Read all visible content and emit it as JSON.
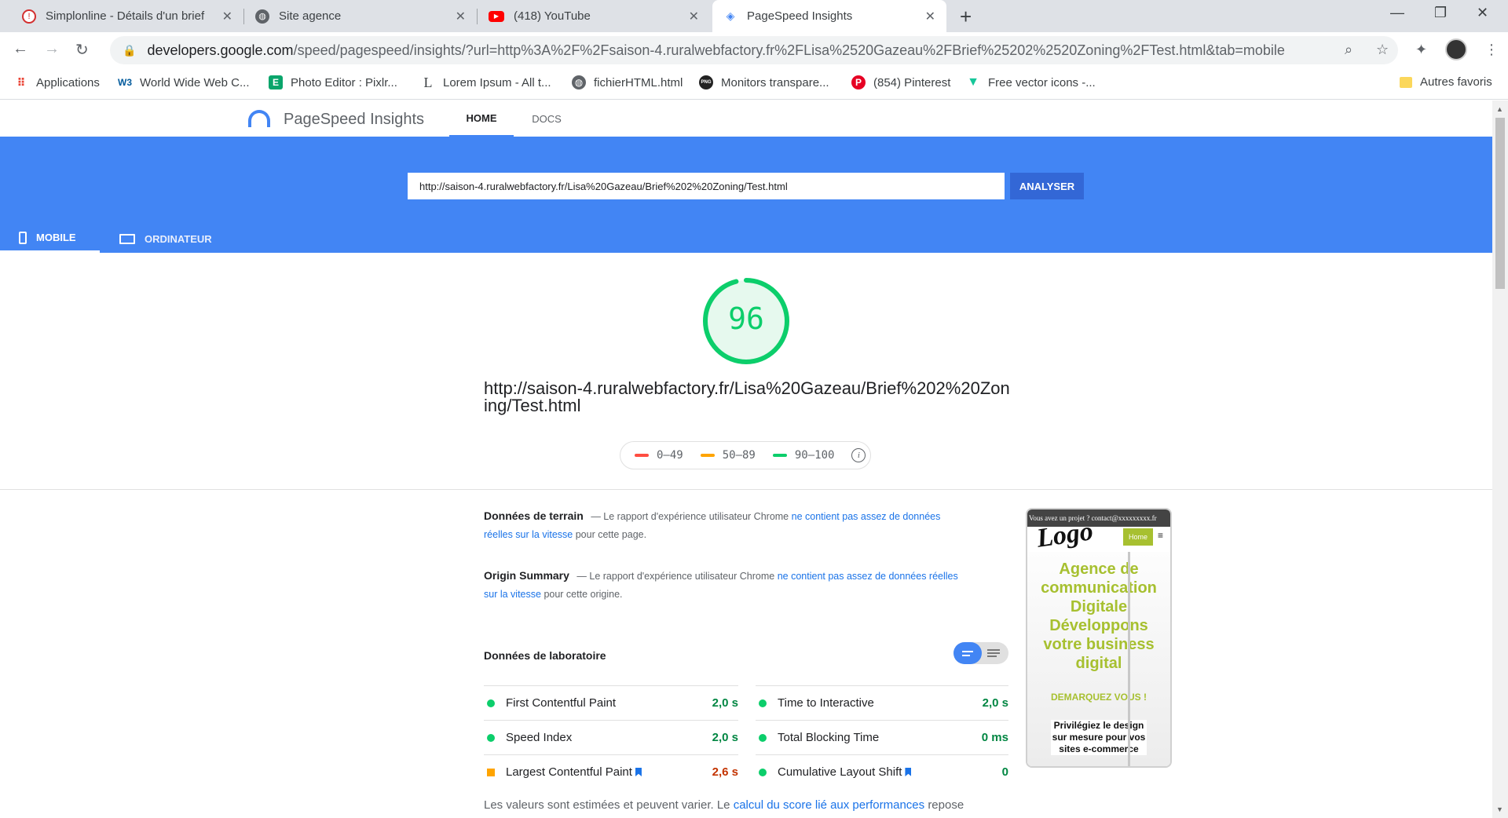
{
  "browser": {
    "tabs": [
      {
        "title": "Simplonline - Détails d'un brief",
        "icon": "simplon-icon"
      },
      {
        "title": "Site agence",
        "icon": "globe-icon"
      },
      {
        "title": "(418) YouTube",
        "icon": "youtube-icon"
      },
      {
        "title": "PageSpeed Insights",
        "icon": "pagespeed-icon",
        "active": true
      }
    ],
    "address": {
      "host": "developers.google.com",
      "path": "/speed/pagespeed/insights/?url=http%3A%2F%2Fsaison-4.ruralwebfactory.fr%2FLisa%2520Gazeau%2FBrief%25202%2520Zoning%2FTest.html&tab=mobile"
    },
    "bookmarks": [
      {
        "label": "Applications",
        "icon": "apps-grid-icon"
      },
      {
        "label": "World Wide Web C...",
        "icon": "w3c-icon"
      },
      {
        "label": "Photo Editor : Pixlr...",
        "icon": "pixlr-icon"
      },
      {
        "label": "Lorem Ipsum - All t...",
        "icon": "lorem-icon"
      },
      {
        "label": "fichierHTML.html",
        "icon": "globe-icon"
      },
      {
        "label": "Monitors transpare...",
        "icon": "png-icon"
      },
      {
        "label": "(854) Pinterest",
        "icon": "pinterest-icon"
      },
      {
        "label": "Free vector icons -...",
        "icon": "vector-icon"
      }
    ],
    "other_bookmarks": "Autres favoris"
  },
  "psi": {
    "title": "PageSpeed Insights",
    "nav": {
      "home": "HOME",
      "docs": "DOCS"
    },
    "url_value": "http://saison-4.ruralwebfactory.fr/Lisa%20Gazeau/Brief%202%20Zoning/Test.html",
    "analyze_label": "ANALYSER",
    "device_tabs": {
      "mobile": "MOBILE",
      "desktop": "ORDINATEUR"
    },
    "score": "96",
    "score_fraction": 0.96,
    "tested_url": "http://saison-4.ruralwebfactory.fr/Lisa%20Gazeau/Brief%202%20Zoning/Test.html",
    "legend": [
      {
        "label": "0–49",
        "color": "#ff4e42"
      },
      {
        "label": "50–89",
        "color": "#ffa400"
      },
      {
        "label": "90–100",
        "color": "#0cce6b"
      }
    ],
    "field": {
      "title": "Données de terrain",
      "text_before": "— Le rapport d'expérience utilisateur Chrome",
      "link": "ne contient pas assez de données réelles sur la vitesse",
      "text_after": "pour cette page."
    },
    "origin": {
      "title": "Origin Summary",
      "text_before": "— Le rapport d'expérience utilisateur Chrome",
      "link": "ne contient pas assez de données réelles sur la vitesse",
      "text_after": "pour cette origine."
    },
    "lab": {
      "title": "Données de laboratoire",
      "metrics": [
        {
          "label": "First Contentful Paint",
          "value": "2,0 s",
          "rating": "good"
        },
        {
          "label": "Time to Interactive",
          "value": "2,0 s",
          "rating": "good"
        },
        {
          "label": "Speed Index",
          "value": "2,0 s",
          "rating": "good"
        },
        {
          "label": "Total Blocking Time",
          "value": "0 ms",
          "rating": "good"
        },
        {
          "label": "Largest Contentful Paint",
          "value": "2,6 s",
          "rating": "average",
          "flag": true
        },
        {
          "label": "Cumulative Layout Shift",
          "value": "0",
          "rating": "good",
          "flag": true
        }
      ]
    },
    "footnote": {
      "before": "Les valeurs sont estimées et peuvent varier. Le",
      "link": "calcul du score lié aux performances",
      "after": "repose"
    },
    "thumbnail": {
      "topbar": "Vous avez un projet ? contact@xxxxxxxxx.fr",
      "logo": "Logo",
      "home": "Home",
      "headline": "Agence de communication Digitale Développons votre business digital",
      "cta": "DEMARQUEZ VOUS !",
      "sub": "Privilégiez le design sur mesure pour vos sites e-commerce"
    }
  },
  "colors": {
    "brand_blue": "#4285f4",
    "good": "#0cce6b",
    "average": "#ffa400",
    "poor": "#ff4e42"
  }
}
